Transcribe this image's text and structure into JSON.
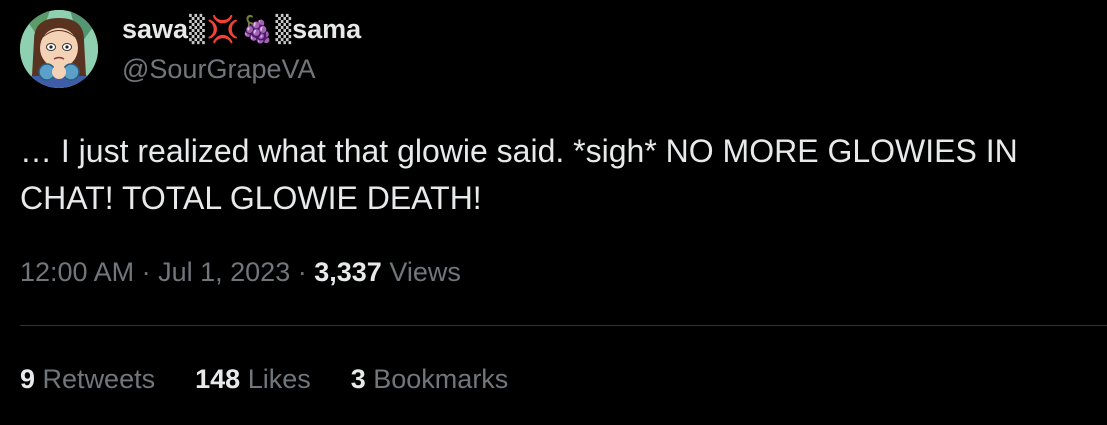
{
  "user": {
    "display_name_prefix": "sawa",
    "emoji_1": "▒",
    "emoji_2": "💢",
    "emoji_3": "🍇",
    "emoji_4": "▒",
    "display_name_suffix": "sama",
    "handle": "@SourGrapeVA",
    "avatar_icon": "avatar-image"
  },
  "tweet": {
    "text": "… I just realized what that glowie said. *sigh* NO MORE GLOWIES IN CHAT! TOTAL GLOWIE DEATH!",
    "time": "12:00 AM",
    "separator": "·",
    "date": "Jul 1, 2023",
    "views_count": "3,337",
    "views_label": "Views"
  },
  "stats": [
    {
      "count": "9",
      "label": "Retweets"
    },
    {
      "count": "148",
      "label": "Likes"
    },
    {
      "count": "3",
      "label": "Bookmarks"
    }
  ],
  "colors": {
    "background": "#000000",
    "primary_text": "#e7e9ea",
    "secondary_text": "#71767b",
    "divider": "#2f3336"
  }
}
